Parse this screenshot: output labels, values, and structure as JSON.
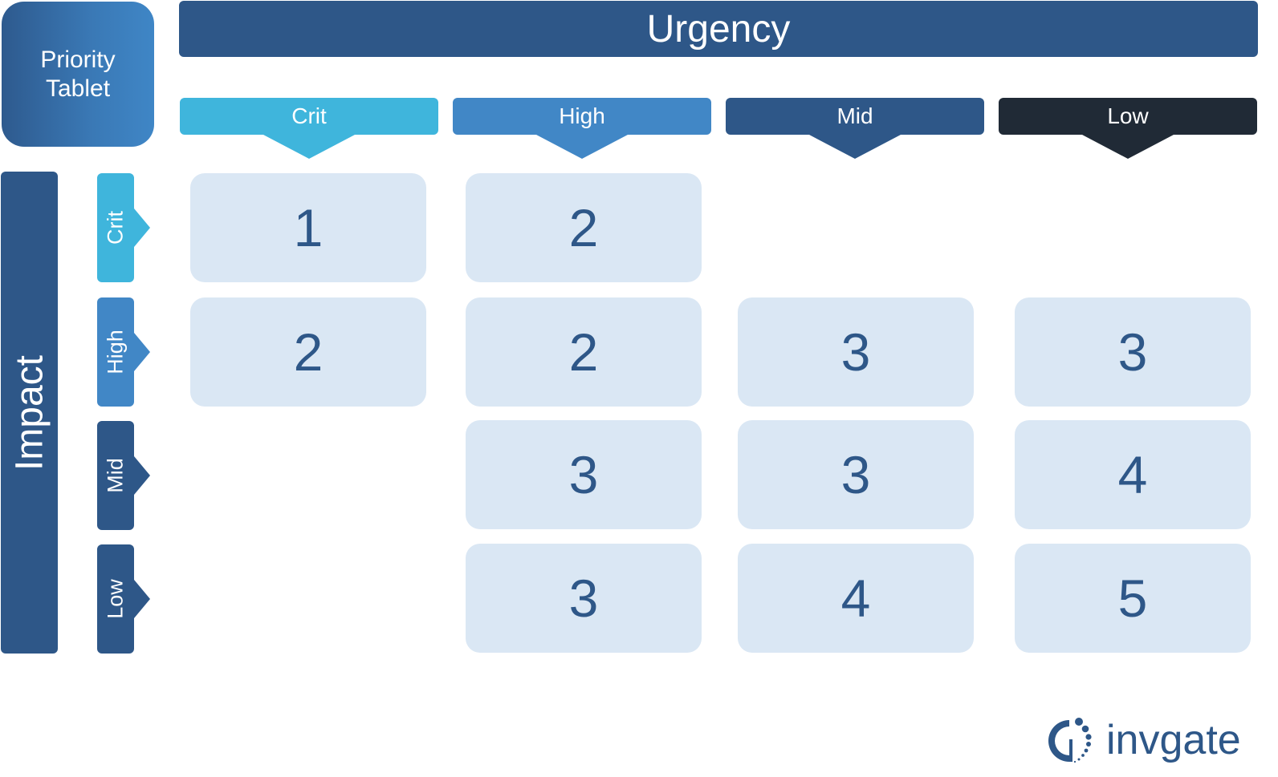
{
  "title": {
    "corner_label_line1": "Priority",
    "corner_label_line2": "Tablet",
    "urgency_label": "Urgency",
    "impact_label": "Impact"
  },
  "colors": {
    "crit": "#3fb5dc",
    "high": "#4187c6",
    "mid": "#2e5788",
    "low": "#202a36",
    "cell_bg": "#dae7f4",
    "cell_text": "#2e5788"
  },
  "urgency_levels": [
    {
      "label": "Crit",
      "color": "#3fb5dc"
    },
    {
      "label": "High",
      "color": "#4187c6"
    },
    {
      "label": "Mid",
      "color": "#2e5788"
    },
    {
      "label": "Low",
      "color": "#202a36"
    }
  ],
  "impact_levels": [
    {
      "label": "Crit",
      "color": "#3fb5dc"
    },
    {
      "label": "High",
      "color": "#4187c6"
    },
    {
      "label": "Mid",
      "color": "#2e5788"
    },
    {
      "label": "Low",
      "color": "#2e5788"
    }
  ],
  "matrix": [
    [
      "1",
      "2",
      null,
      null
    ],
    [
      "2",
      "2",
      "3",
      "3"
    ],
    [
      null,
      "3",
      "3",
      "4"
    ],
    [
      null,
      "3",
      "4",
      "5"
    ]
  ],
  "chart_data": {
    "type": "table",
    "title": "Priority Tablet",
    "xlabel": "Urgency",
    "ylabel": "Impact",
    "columns": [
      "Crit",
      "High",
      "Mid",
      "Low"
    ],
    "rows": [
      "Crit",
      "High",
      "Mid",
      "Low"
    ],
    "values": [
      [
        1,
        2,
        null,
        null
      ],
      [
        2,
        2,
        3,
        3
      ],
      [
        null,
        3,
        3,
        4
      ],
      [
        null,
        3,
        4,
        5
      ]
    ]
  },
  "logo": {
    "text": "invgate",
    "icon": "invgate-logo-icon"
  }
}
